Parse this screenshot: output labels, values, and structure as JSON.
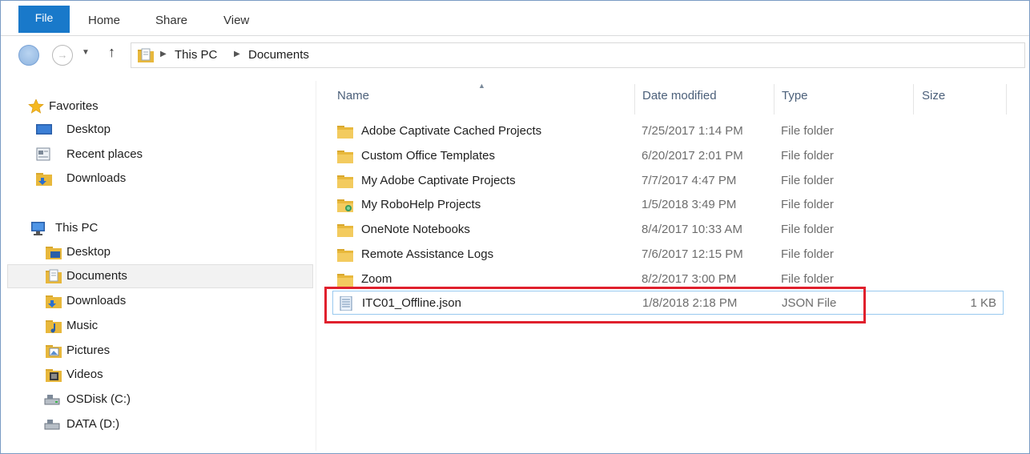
{
  "ribbon": {
    "tabs": [
      "File",
      "Home",
      "Share",
      "View"
    ]
  },
  "address": {
    "crumbs": [
      "This PC",
      "Documents"
    ]
  },
  "navpane": {
    "favorites_label": "Favorites",
    "favorites": [
      "Desktop",
      "Recent places",
      "Downloads"
    ],
    "thispc_label": "This PC",
    "thispc_items": [
      "Desktop",
      "Documents",
      "Downloads",
      "Music",
      "Pictures",
      "Videos",
      "OSDisk (C:)",
      "DATA (D:)"
    ],
    "selected": "Documents"
  },
  "columns": {
    "name": "Name",
    "date": "Date modified",
    "type": "Type",
    "size": "Size"
  },
  "files": [
    {
      "name": "Adobe Captivate Cached Projects",
      "date": "7/25/2017 1:14 PM",
      "type": "File folder",
      "size": "",
      "icon": "folder-icon"
    },
    {
      "name": "Custom Office Templates",
      "date": "6/20/2017 2:01 PM",
      "type": "File folder",
      "size": "",
      "icon": "folder-icon"
    },
    {
      "name": "My Adobe Captivate Projects",
      "date": "7/7/2017 4:47 PM",
      "type": "File folder",
      "size": "",
      "icon": "folder-icon"
    },
    {
      "name": "My RoboHelp Projects",
      "date": "1/5/2018 3:49 PM",
      "type": "File folder",
      "size": "",
      "icon": "network-folder-icon"
    },
    {
      "name": "OneNote Notebooks",
      "date": "8/4/2017 10:33 AM",
      "type": "File folder",
      "size": "",
      "icon": "folder-icon"
    },
    {
      "name": "Remote Assistance Logs",
      "date": "7/6/2017 12:15 PM",
      "type": "File folder",
      "size": "",
      "icon": "folder-icon"
    },
    {
      "name": "Zoom",
      "date": "8/2/2017 3:00 PM",
      "type": "File folder",
      "size": "",
      "icon": "folder-icon"
    },
    {
      "name": "ITC01_Offline.json",
      "date": "1/8/2018 2:18 PM",
      "type": "JSON File",
      "size": "1 KB",
      "icon": "text-file-icon"
    }
  ],
  "colors": {
    "file_tab": "#1979ca",
    "highlight": "#e0202d",
    "selected_border": "#99c9ef"
  }
}
